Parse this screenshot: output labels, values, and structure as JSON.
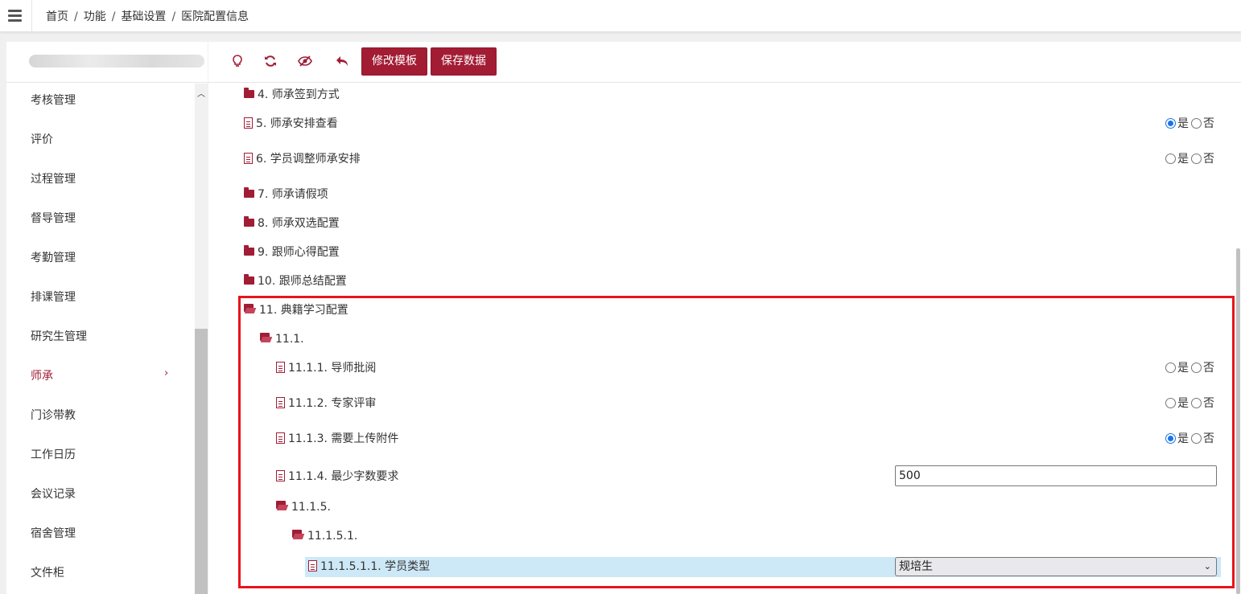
{
  "breadcrumb": [
    "首页",
    "功能",
    "基础设置",
    "医院配置信息"
  ],
  "sidebar": {
    "items": [
      {
        "label": "考核管理"
      },
      {
        "label": "评价"
      },
      {
        "label": "过程管理"
      },
      {
        "label": "督导管理"
      },
      {
        "label": "考勤管理"
      },
      {
        "label": "排课管理"
      },
      {
        "label": "研究生管理"
      },
      {
        "label": "师承",
        "active": true
      },
      {
        "label": "门诊带教"
      },
      {
        "label": "工作日历"
      },
      {
        "label": "会议记录"
      },
      {
        "label": "宿舍管理"
      },
      {
        "label": "文件柜"
      }
    ]
  },
  "toolbar": {
    "icons": [
      "lightbulb-icon",
      "refresh-icon",
      "eye-slash-icon",
      "undo-icon"
    ],
    "edit_template_label": "修改模板",
    "save_data_label": "保存数据"
  },
  "radio_labels": {
    "yes": "是",
    "no": "否"
  },
  "tree": {
    "n4": "4. 师承签到方式",
    "n5": "5. 师承安排查看",
    "n5_value": "yes",
    "n6": "6. 学员调整师承安排",
    "n6_value": "none",
    "n7": "7. 师承请假项",
    "n8": "8. 师承双选配置",
    "n9": "9. 跟师心得配置",
    "n10": "10. 跟师总结配置",
    "n11": "11. 典籍学习配置",
    "n11_1": "11.1.",
    "n11_1_1": "11.1.1. 导师批阅",
    "n11_1_1_value": "none",
    "n11_1_2": "11.1.2. 专家评审",
    "n11_1_2_value": "none",
    "n11_1_3": "11.1.3. 需要上传附件",
    "n11_1_3_value": "yes",
    "n11_1_4": "11.1.4. 最少字数要求",
    "n11_1_4_value": "500",
    "n11_1_5": "11.1.5.",
    "n11_1_5_1": "11.1.5.1.",
    "n11_1_5_1_1": "11.1.5.1.1. 学员类型",
    "n11_1_5_1_1_value": "规培生"
  },
  "colors": {
    "accent": "#a21c34",
    "highlight_border": "#e8141a",
    "selected_row": "#cde8f7"
  }
}
